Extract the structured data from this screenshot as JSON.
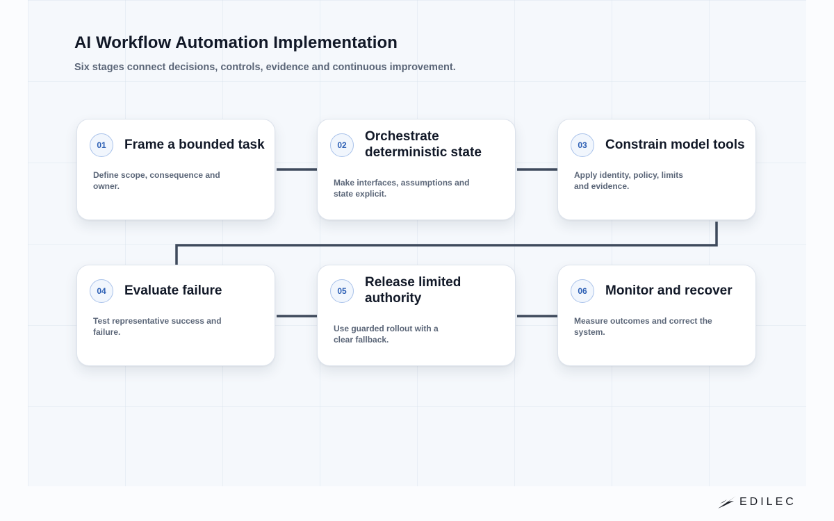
{
  "header": {
    "title": "AI Workflow Automation Implementation",
    "subtitle": "Six stages connect decisions, controls, evidence and continuous improvement."
  },
  "stages": [
    {
      "number": "01",
      "title": "Frame a bounded task",
      "description": "Define scope, consequence and owner."
    },
    {
      "number": "02",
      "title": "Orchestrate deterministic state",
      "description": "Make interfaces, assumptions and state explicit."
    },
    {
      "number": "03",
      "title": "Constrain model tools",
      "description": "Apply identity, policy, limits and evidence."
    },
    {
      "number": "04",
      "title": "Evaluate failure",
      "description": "Test representative success and failure."
    },
    {
      "number": "05",
      "title": "Release limited authority",
      "description": "Use guarded rollout with a clear fallback."
    },
    {
      "number": "06",
      "title": "Monitor and recover",
      "description": "Measure outcomes and correct the system."
    }
  ],
  "flow": [
    [
      "01",
      "02"
    ],
    [
      "02",
      "03"
    ],
    [
      "03",
      "04"
    ],
    [
      "04",
      "05"
    ],
    [
      "05",
      "06"
    ]
  ],
  "brand": {
    "name": "EDILEC"
  },
  "colors": {
    "connector": "#3f4a5c",
    "badge_text": "#2c5fb4",
    "badge_border": "#a9c2ea",
    "title_text": "#111827",
    "body_text": "#5b6678"
  }
}
